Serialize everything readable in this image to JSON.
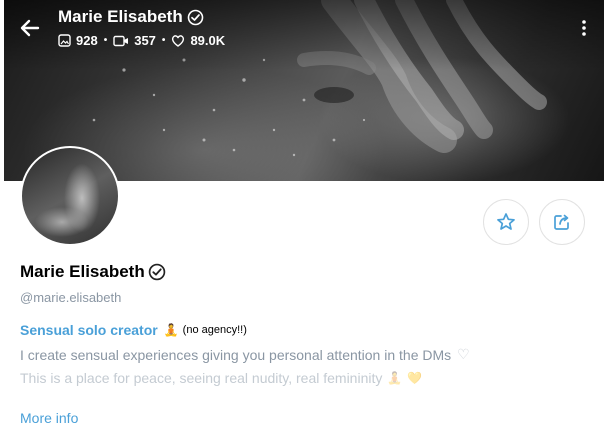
{
  "header": {
    "title": "Marie Elisabeth",
    "stats": {
      "photos": "928",
      "videos": "357",
      "likes": "89.0K"
    },
    "separator": "•"
  },
  "icons": {
    "back": "arrow-left-icon",
    "verified": "verified-badge-icon",
    "photos": "image-icon",
    "videos": "video-icon",
    "likes": "heart-icon",
    "menu": "kebab-menu-icon",
    "favorite": "star-icon",
    "share": "share-icon"
  },
  "profile": {
    "name": "Marie Elisabeth",
    "handle": "@marie.elisabeth"
  },
  "bio": {
    "heading": "Sensual solo creator",
    "heading_emoji": "🧘",
    "heading_note": "(no agency!!)",
    "line1": "I create sensual experiences giving you personal attention in the DMs",
    "line1_emoji": "♡",
    "line2": "This is a place for peace, seeing real nudity, real femininity",
    "line2_emoji1": "🧘",
    "line2_emoji2": "💛"
  },
  "more_info_label": "More info",
  "colors": {
    "accent": "#4aa0d8",
    "muted_text": "#8a96a3",
    "faded_text": "#c4cbd2",
    "button_border": "#e2e2e2"
  }
}
